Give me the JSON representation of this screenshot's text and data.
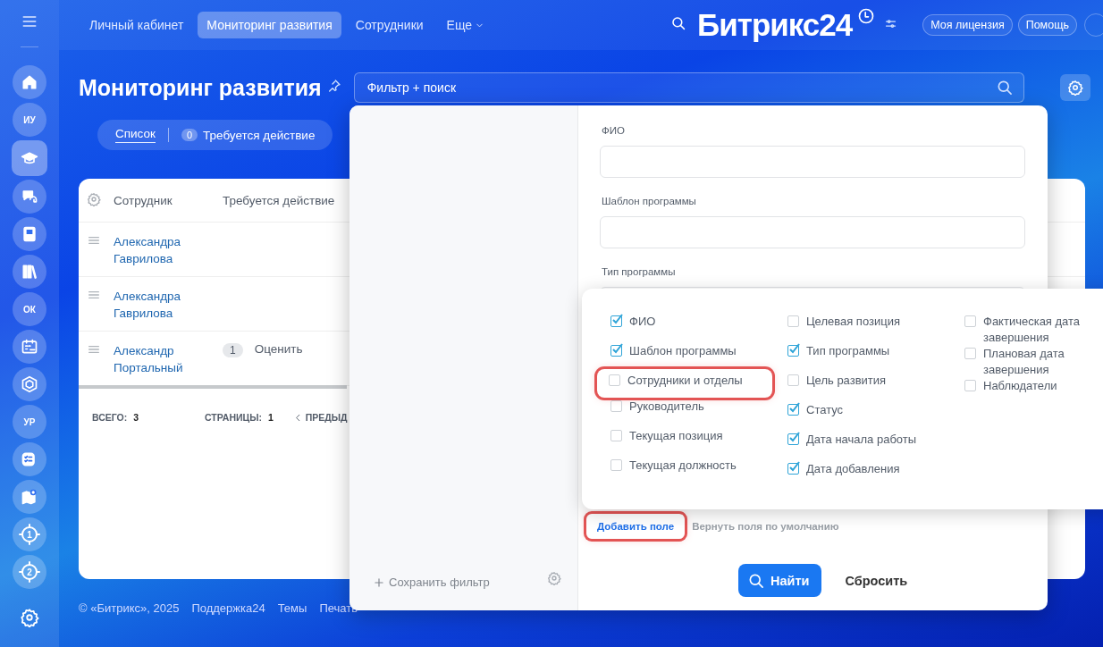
{
  "sidebar": {
    "items": [
      {
        "kind": "home",
        "selected": false
      },
      {
        "kind": "initials",
        "label": "ИУ",
        "selected": false
      },
      {
        "kind": "cap",
        "selected": true
      },
      {
        "kind": "chat",
        "selected": false
      },
      {
        "kind": "book",
        "selected": false
      },
      {
        "kind": "library",
        "selected": false
      },
      {
        "kind": "initials",
        "label": "ОК",
        "selected": false
      },
      {
        "kind": "calendar",
        "selected": false
      },
      {
        "kind": "hexagon",
        "selected": false
      },
      {
        "kind": "initials",
        "label": "УР",
        "selected": false
      },
      {
        "kind": "checklist",
        "selected": false
      },
      {
        "kind": "map",
        "selected": false
      },
      {
        "kind": "target",
        "label": "1",
        "selected": false
      },
      {
        "kind": "target",
        "label": "2",
        "selected": false
      }
    ]
  },
  "top_nav": {
    "tabs": [
      {
        "label": "Личный кабинет",
        "selected": false
      },
      {
        "label": "Мониторинг развития",
        "selected": true
      },
      {
        "label": "Сотрудники",
        "selected": false
      }
    ],
    "more": "Еще",
    "logo": "Битрикс24",
    "buttons": [
      "Моя лицензия",
      "Помощь"
    ]
  },
  "page": {
    "title": "Мониторинг развития",
    "search": {
      "placeholder": "Фильтр + поиск"
    },
    "views": [
      {
        "label": "Список",
        "selected": true
      },
      {
        "count": "0",
        "label": "Требуется действие",
        "selected": false
      }
    ]
  },
  "table": {
    "columns": [
      "Сотрудник",
      "Требуется действие"
    ],
    "rows": [
      {
        "name": "Александра Гаврилова"
      },
      {
        "name": "Александра Гаврилова"
      },
      {
        "name": "Александр Портальный",
        "badge": "1",
        "action": "Оценить"
      }
    ],
    "total_label": "ВСЕГО:",
    "total": "3",
    "pages_label": "СТРАНИЦЫ:",
    "pages": "1",
    "prev": "ПРЕДЫД"
  },
  "footer": [
    "© «Битрикс», 2025",
    "Поддержка24",
    "Темы",
    "Печать"
  ],
  "filter": {
    "save": "Сохранить фильтр",
    "fields": [
      {
        "label": "ФИО"
      },
      {
        "label": "Шаблон программы"
      },
      {
        "label": "Тип программы"
      }
    ],
    "add_field": {
      "label": "Добавить поле",
      "highlighted": true
    },
    "restore": "Вернуть поля по умолчанию",
    "find": "Найти",
    "reset": "Сбросить"
  },
  "field_menu": {
    "columns": [
      [
        {
          "label": "ФИО",
          "checked": true,
          "highlighted": false
        },
        {
          "label": "Шаблон программы",
          "checked": true,
          "highlighted": false
        },
        {
          "label": "Сотрудники и отделы",
          "checked": false,
          "highlighted": true
        },
        {
          "label": "Руководитель",
          "checked": false,
          "highlighted": false
        },
        {
          "label": "Текущая позиция",
          "checked": false,
          "highlighted": false
        },
        {
          "label": "Текущая должность",
          "checked": false,
          "highlighted": false
        }
      ],
      [
        {
          "label": "Целевая позиция",
          "checked": false,
          "highlighted": false
        },
        {
          "label": "Тип программы",
          "checked": true,
          "highlighted": false
        },
        {
          "label": "Цель развития",
          "checked": false,
          "highlighted": false
        },
        {
          "label": "Статус",
          "checked": true,
          "highlighted": false
        },
        {
          "label": "Дата начала работы",
          "checked": true,
          "highlighted": false
        },
        {
          "label": "Дата добавления",
          "checked": true,
          "highlighted": false
        }
      ],
      [
        {
          "label": "Фактическая дата завершения",
          "checked": false,
          "highlighted": false
        },
        {
          "label": "Плановая дата завершения",
          "checked": false,
          "highlighted": false
        },
        {
          "label": "Наблюдатели",
          "checked": false,
          "highlighted": false
        }
      ]
    ]
  }
}
